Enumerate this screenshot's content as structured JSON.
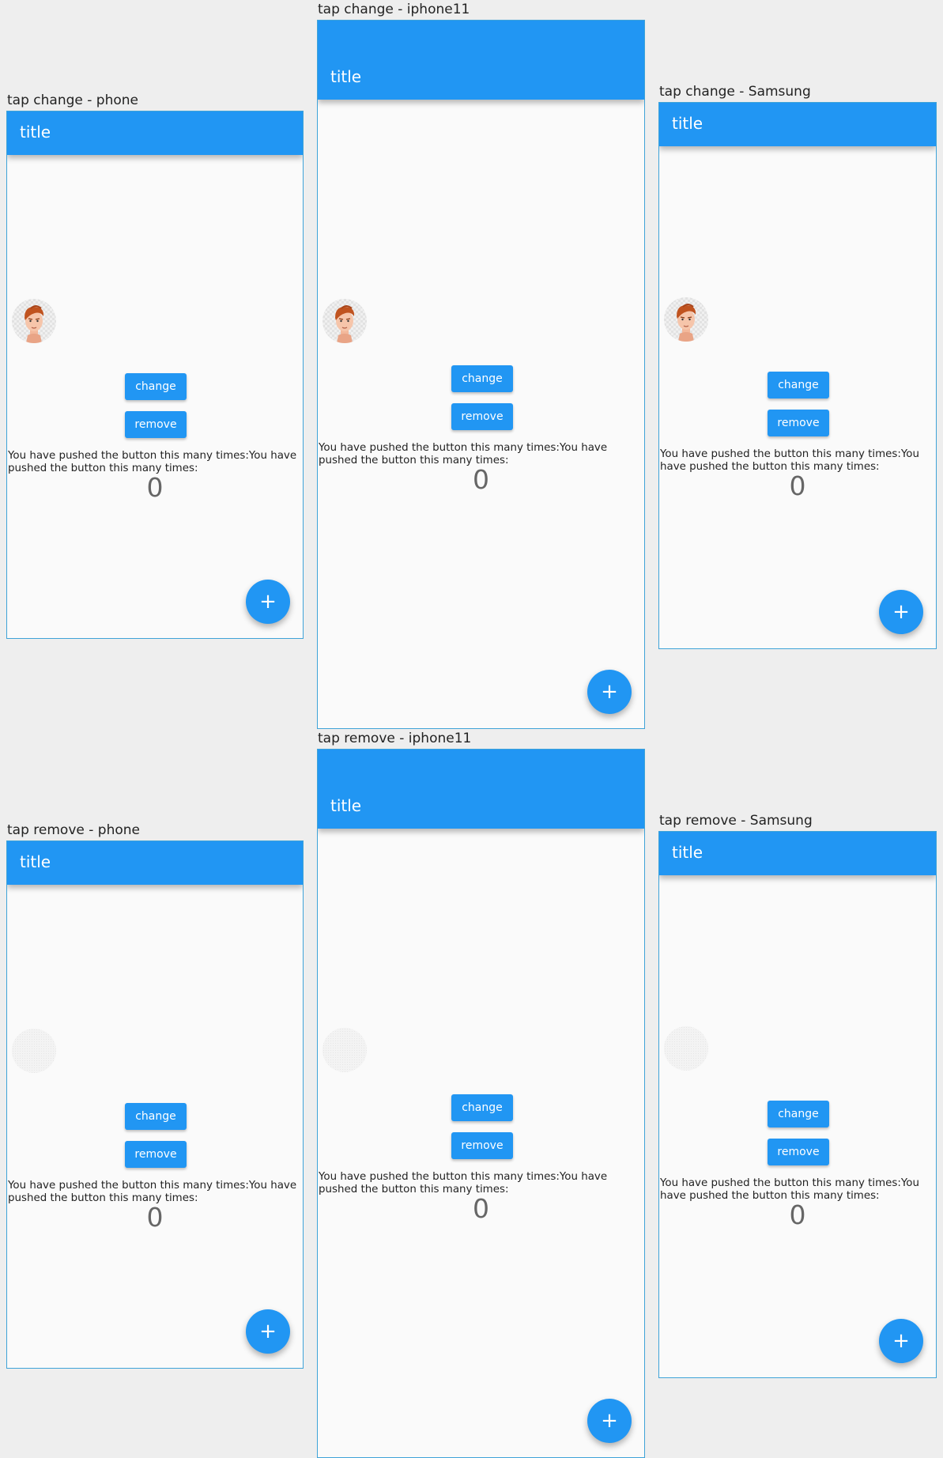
{
  "app_title": "title",
  "change_label": "change",
  "remove_label": "remove",
  "message": "You have pushed the button this many times:You have pushed the button this many times:",
  "counter": "0",
  "fab_icon": "+",
  "frames": [
    {
      "caption": "tap change - phone",
      "avatar": "face"
    },
    {
      "caption": "tap change - iphone11",
      "avatar": "face"
    },
    {
      "caption": "tap change - Samsung",
      "avatar": "face"
    },
    {
      "caption": "tap remove - phone",
      "avatar": "empty"
    },
    {
      "caption": "tap remove - iphone11",
      "avatar": "empty"
    },
    {
      "caption": "tap remove - Samsung",
      "avatar": "empty"
    }
  ],
  "colors": {
    "primary": "#2196f3",
    "background": "#fafafa",
    "canvas": "#eeeeee"
  }
}
